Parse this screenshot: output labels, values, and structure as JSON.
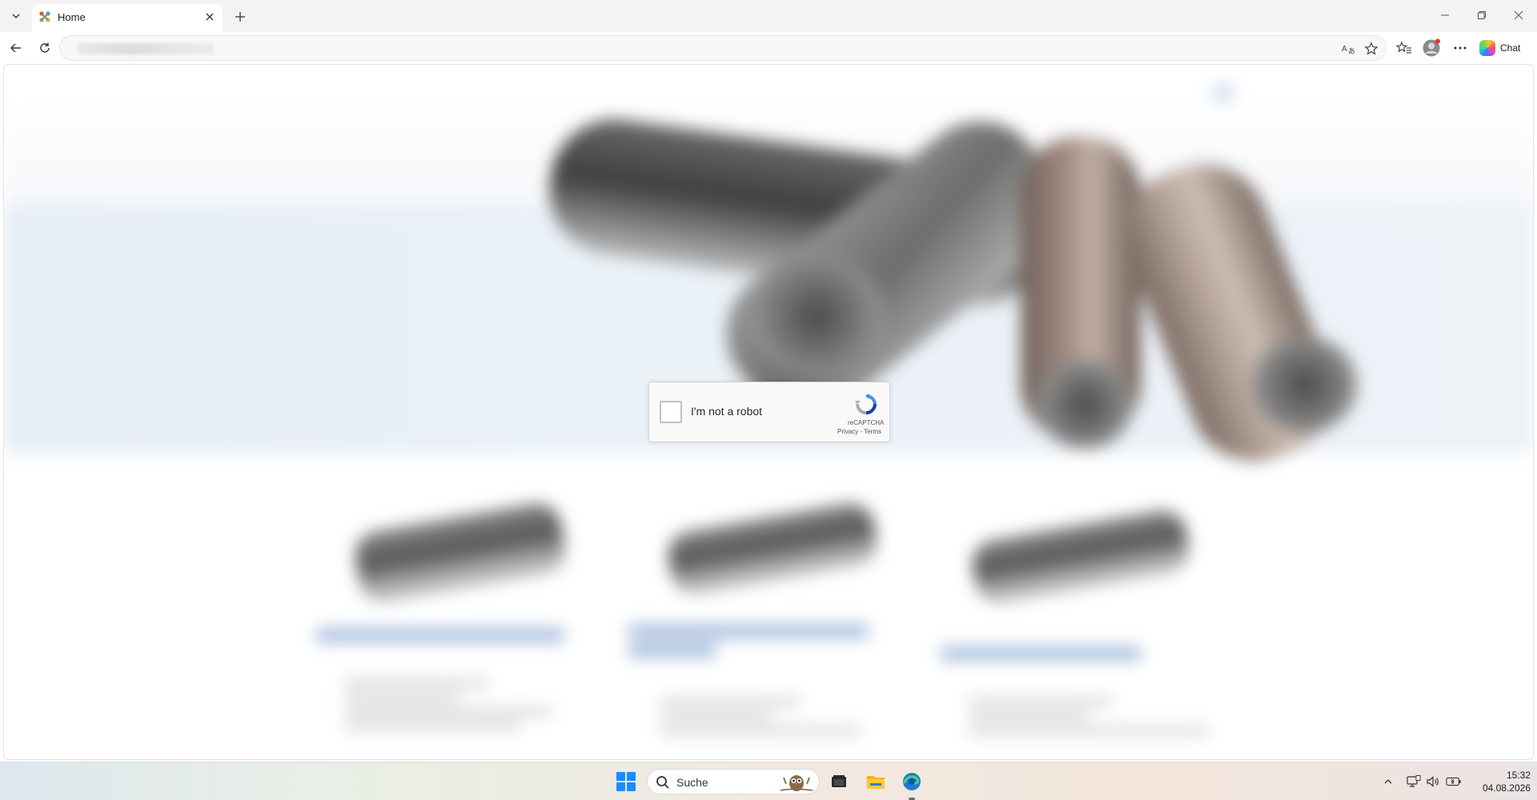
{
  "browser": {
    "tab": {
      "title": "Home",
      "favicon": "joomla-icon"
    },
    "toolbar": {
      "chat_label": "Chat"
    },
    "icons": [
      "tab-list-icon",
      "close-icon",
      "plus-icon",
      "minimize-icon",
      "restore-icon",
      "close-window-icon",
      "back-arrow-icon",
      "reload-icon",
      "translate-icon",
      "star-icon",
      "favorites-icon",
      "profile-icon",
      "more-icon",
      "copilot-icon"
    ]
  },
  "recaptcha": {
    "label": "I'm not a robot",
    "brand": "reCAPTCHA",
    "privacy": "Privacy",
    "separator": " - ",
    "terms": "Terms",
    "checked": false
  },
  "taskbar": {
    "search_placeholder": "Suche",
    "apps": [
      "windows-start-icon",
      "task-view-icon",
      "file-explorer-icon",
      "edge-icon"
    ],
    "tray": [
      "chevron-up-icon",
      "network-icon",
      "volume-icon",
      "battery-icon"
    ],
    "clock": {
      "time": "15:32",
      "date": "04.08.2026"
    }
  },
  "colors": {
    "accent_blue": "#1a8cff",
    "recaptcha_blue": "#1c3aa9"
  }
}
